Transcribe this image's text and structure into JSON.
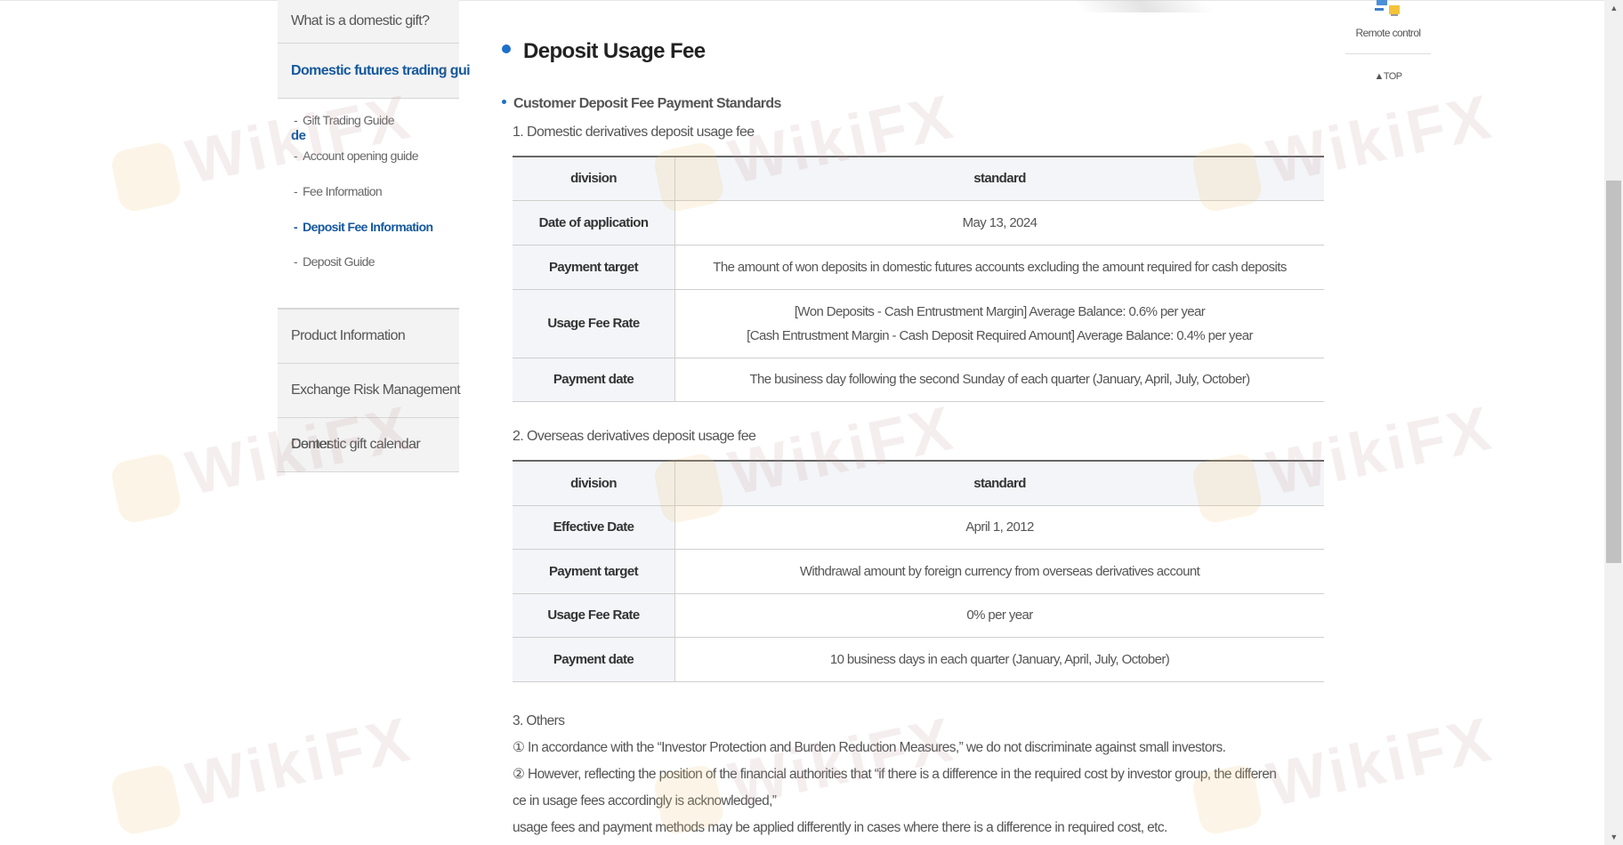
{
  "sidebar": {
    "what_is": "What is a domestic gift?",
    "active": "Domestic futures trading gui",
    "active_wrap": "de",
    "subs": [
      {
        "label": "Gift Trading Guide",
        "current": false
      },
      {
        "label": "Account opening guide",
        "current": false
      },
      {
        "label": "Fee Information",
        "current": false
      },
      {
        "label": "Deposit Fee Information",
        "current": true
      },
      {
        "label": "Deposit Guide",
        "current": false
      }
    ],
    "dash": "-",
    "product_info": "Product Information",
    "exchange_risk": "Exchange Risk Management",
    "calendar": "Domestic gift calendar",
    "calendar_overlap": "Center"
  },
  "page": {
    "title": "Deposit Usage Fee",
    "section_title": "Customer Deposit Fee Payment Standards"
  },
  "table1": {
    "heading": "1. Domestic derivatives deposit usage fee",
    "col1": "division",
    "col2": "standard",
    "rows": [
      {
        "label": "Date of application",
        "value": "May 13, 2024"
      },
      {
        "label": "Payment target",
        "value": "The amount of won deposits in domestic futures accounts excluding the amount required for cash deposits"
      },
      {
        "label": "Usage Fee Rate",
        "value": "[Won Deposits - Cash Entrustment Margin] Average Balance: 0.6% per year",
        "value2": "[Cash Entrustment Margin - Cash Deposit Required Amount] Average Balance: 0.4% per year"
      },
      {
        "label": "Payment date",
        "value": "The business day following the second Sunday of each quarter (January, April, July, October)"
      }
    ]
  },
  "table2": {
    "heading": "2. Overseas derivatives deposit usage fee",
    "col1": "division",
    "col2": "standard",
    "rows": [
      {
        "label": "Effective Date",
        "value": "April 1, 2012"
      },
      {
        "label": "Payment target",
        "value": "Withdrawal amount by foreign currency from overseas derivatives account"
      },
      {
        "label": "Usage Fee Rate",
        "value": "0% per year"
      },
      {
        "label": "Payment date",
        "value": "10 business days in each quarter (January, April, July, October)"
      }
    ]
  },
  "others": {
    "heading": "3. Others",
    "line1": "① In accordance with the “Investor Protection and Burden Reduction Measures,” we do not discriminate against small investors.",
    "line2a": "② However, reflecting the position of the financial authorities that “if there is a difference in the required cost by investor group, the differen",
    "line2b": "ce in usage fees accordingly is acknowledged,”",
    "line3": "usage fees and payment methods may be applied differently in cases where there is a difference in required cost, etc."
  },
  "quick": {
    "remote": "Remote control",
    "top": "▲TOP"
  },
  "watermark": "WikiFX",
  "colors": {
    "accent_blue": "#14589e",
    "bullet_blue": "#1d6fc9",
    "label_bg": "#f3f5f8",
    "menu_bg": "#f3f3f3"
  }
}
